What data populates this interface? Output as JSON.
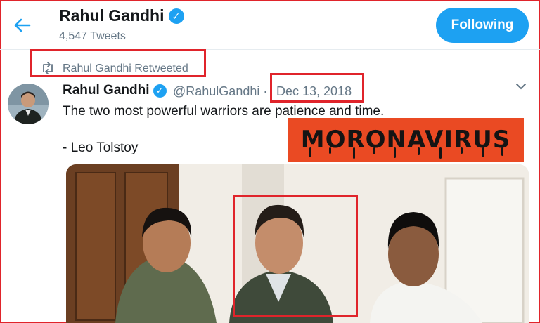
{
  "header": {
    "profile_name": "Rahul Gandhi",
    "tweet_count": "4,547 Tweets",
    "follow_label": "Following"
  },
  "retweet": {
    "text": "Rahul Gandhi Retweeted"
  },
  "tweet": {
    "author_name": "Rahul Gandhi",
    "handle": "@RahulGandhi",
    "separator": "·",
    "date": "Dec 13, 2018",
    "body_line1": "The two most powerful warriors are patience and time.",
    "body_line2": "- Leo Tolstoy"
  },
  "overlay": {
    "stamp_text": "MORONAVIRUS"
  },
  "icons": [
    "back-arrow-icon",
    "verified-badge-icon",
    "retweet-icon",
    "chevron-down-icon"
  ],
  "colors": {
    "accent": "#1da1f2",
    "annotation_red": "#e0242b",
    "stamp_bg": "#ea4a23"
  }
}
